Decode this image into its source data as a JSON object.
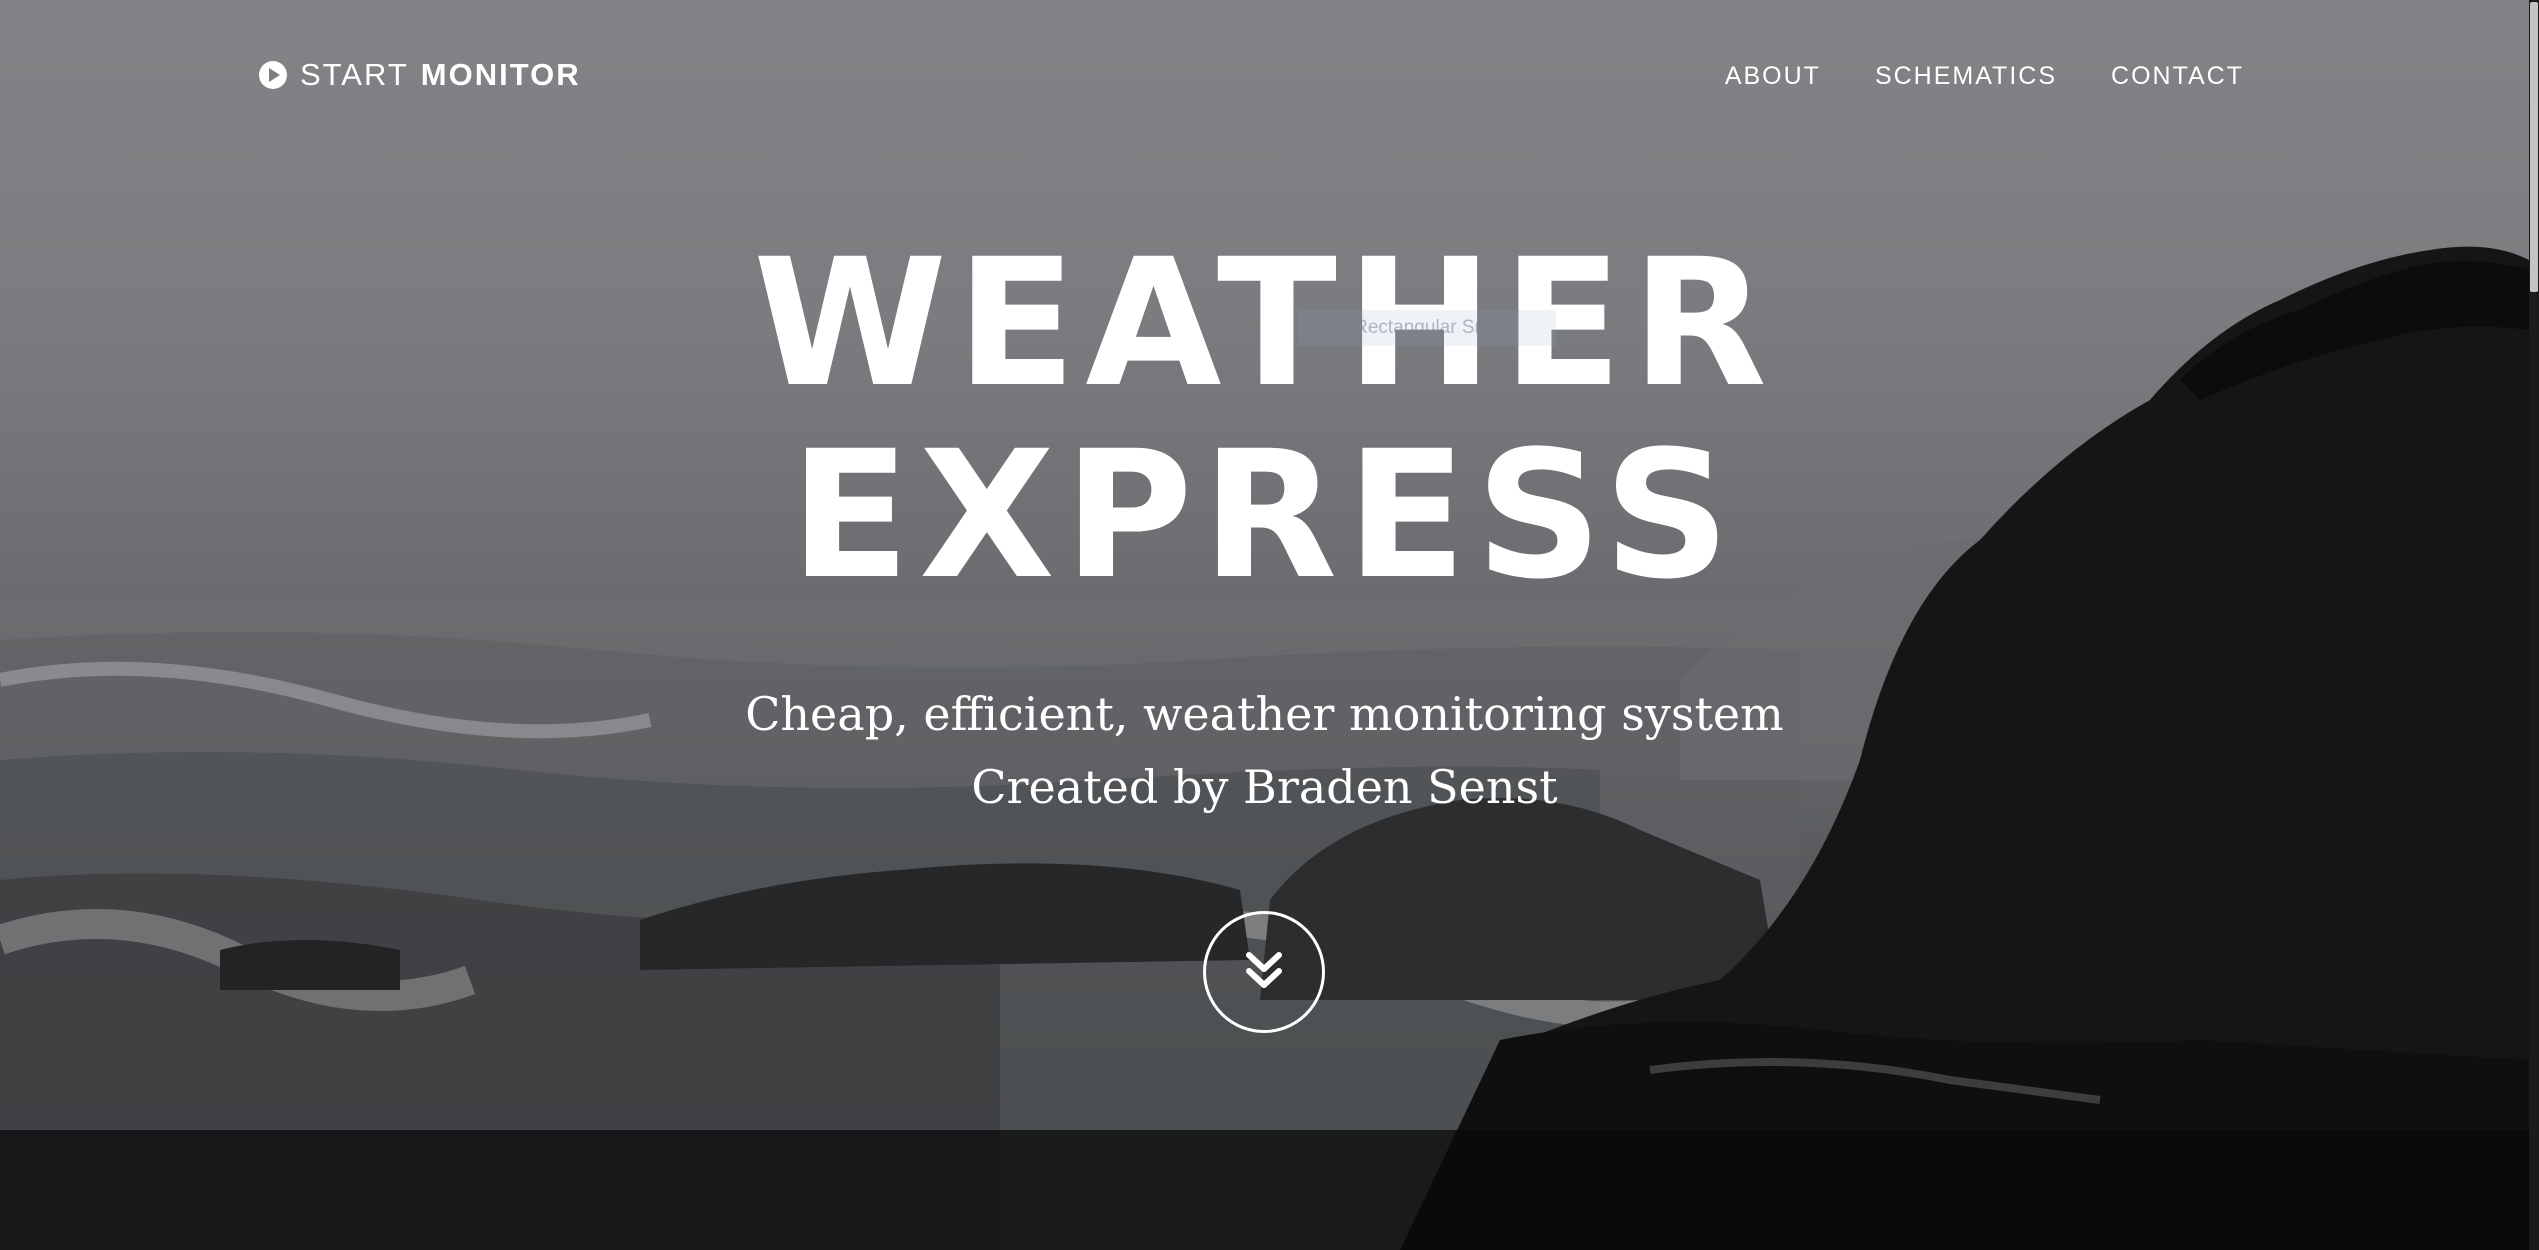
{
  "nav": {
    "brand_first": "START",
    "brand_second": "MONITOR",
    "brand_icon": "play-circle-icon",
    "links": [
      {
        "label": "ABOUT"
      },
      {
        "label": "SCHEMATICS"
      },
      {
        "label": "CONTACT"
      }
    ]
  },
  "hero": {
    "title_line1": "WEATHER",
    "title_line2": "EXPRESS",
    "subtitle_line1": "Cheap, efficient, weather monitoring system",
    "subtitle_line2": "Created by Braden Senst",
    "scroll_icon": "double-chevron-down-icon"
  },
  "overlay": {
    "snip_label": "Rectangular Snip"
  },
  "colors": {
    "text": "#ffffff",
    "sky": "#818386",
    "rock": "#121212"
  }
}
